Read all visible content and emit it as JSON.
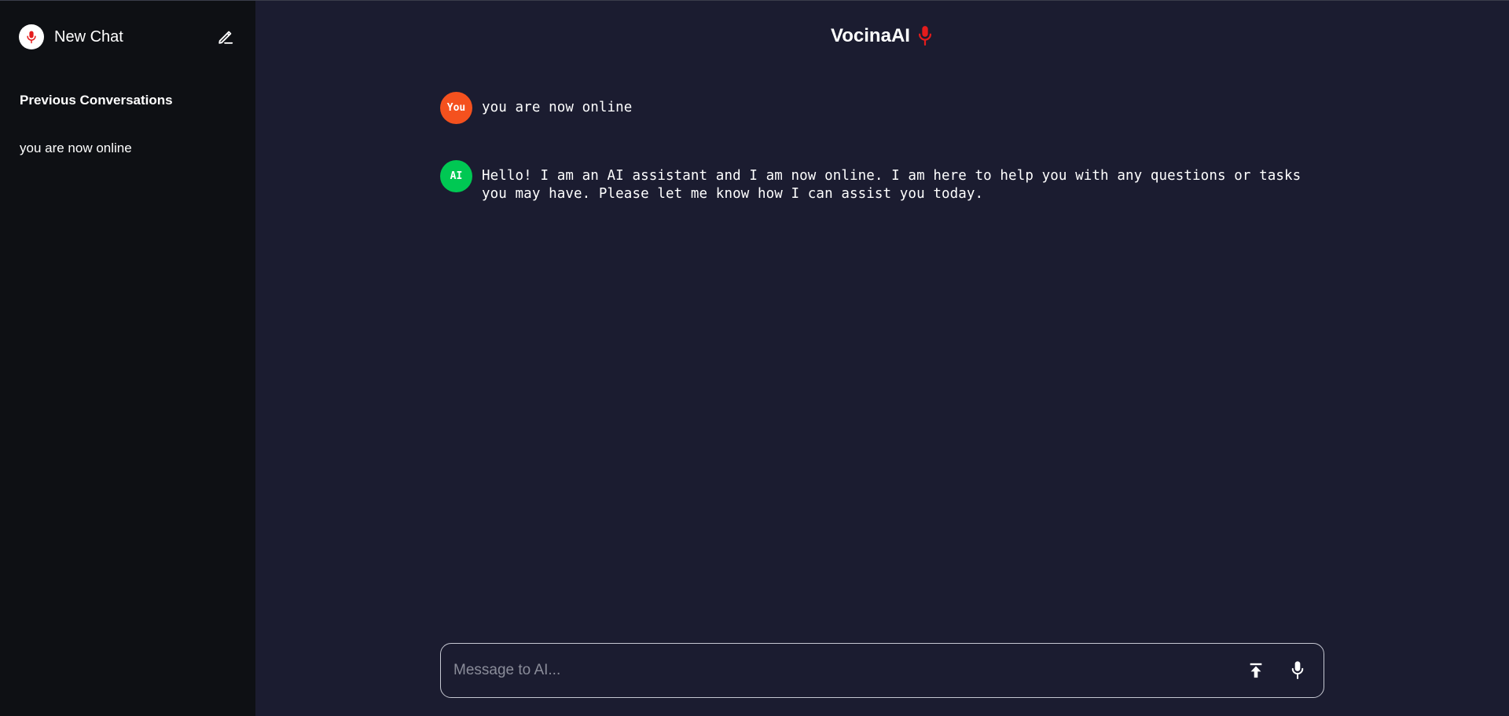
{
  "sidebar": {
    "new_chat_label": "New Chat",
    "previous_title": "Previous Conversations",
    "history": [
      {
        "label": "you are now online"
      }
    ]
  },
  "header": {
    "title": "VocinaAI",
    "icon": "microphone-icon"
  },
  "messages": [
    {
      "role": "user",
      "avatar_label": "You",
      "text": "you are now online"
    },
    {
      "role": "ai",
      "avatar_label": "AI",
      "text": "Hello! I am an AI assistant and I am now online. I am here to help you with any questions or tasks you may have. Please let me know how I can assist you today."
    }
  ],
  "composer": {
    "placeholder": "Message to AI...",
    "value": "",
    "upload_icon": "upload-icon",
    "mic_icon": "microphone-icon"
  },
  "colors": {
    "sidebar_bg": "#0e1014",
    "main_bg": "#1b1c30",
    "brand_red": "#e51c1c",
    "user_avatar": "#f4511e",
    "ai_avatar": "#00c853"
  }
}
